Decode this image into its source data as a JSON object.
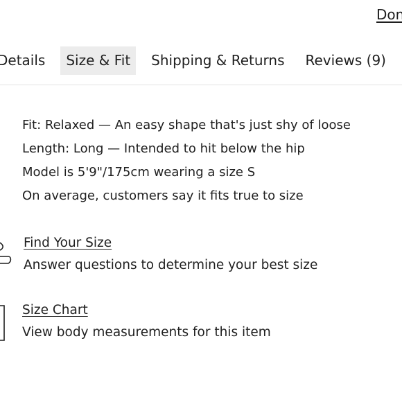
{
  "header": {
    "done_label": "Done"
  },
  "tabs": [
    {
      "label": "Details",
      "active": false
    },
    {
      "label": "Size & Fit",
      "active": true
    },
    {
      "label": "Shipping & Returns",
      "active": false
    },
    {
      "label": "Reviews (9)",
      "active": false
    }
  ],
  "fit_details": [
    "Fit: Relaxed — An easy shape that's just shy of loose",
    "Length: Long — Intended to hit below the hip",
    "Model is 5'9\"/175cm wearing a size S",
    "On average, customers say it fits true to size"
  ],
  "find_your_size": {
    "link_label": "Find Your Size",
    "description": "Answer questions to determine your best size",
    "icon": "measuring-tape-icon"
  },
  "size_chart": {
    "link_label": "Size Chart",
    "description": "View body measurements for this item",
    "icon": "ruler-icon"
  }
}
